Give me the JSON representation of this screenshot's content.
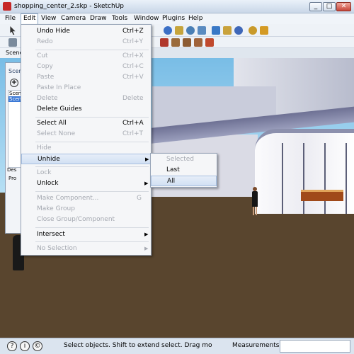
{
  "window": {
    "title": "shopping_center_2.skp - SketchUp",
    "min": "_",
    "max": "□",
    "close": "✕"
  },
  "menubar": [
    "File",
    "Edit",
    "View",
    "Camera",
    "Draw",
    "Tools",
    "Window",
    "Plugins",
    "Help"
  ],
  "scenes_tab": "Scene",
  "scenes_panel": {
    "title": "Scen",
    "list_header": "Scen",
    "selected_item": "Scen",
    "desc_label": "Des",
    "props_label": "Pro"
  },
  "edit_menu": [
    {
      "label": "Undo Hide",
      "shortcut": "Ctrl+Z",
      "enabled": true
    },
    {
      "label": "Redo",
      "shortcut": "Ctrl+Y",
      "enabled": false
    },
    {
      "label": "Cut",
      "shortcut": "Ctrl+X",
      "enabled": false
    },
    {
      "label": "Copy",
      "shortcut": "Ctrl+C",
      "enabled": false
    },
    {
      "label": "Paste",
      "shortcut": "Ctrl+V",
      "enabled": false
    },
    {
      "label": "Paste In Place",
      "shortcut": "",
      "enabled": false
    },
    {
      "label": "Delete",
      "shortcut": "Delete",
      "enabled": false
    },
    {
      "label": "Delete Guides",
      "shortcut": "",
      "enabled": true
    },
    {
      "label": "Select All",
      "shortcut": "Ctrl+A",
      "enabled": true
    },
    {
      "label": "Select None",
      "shortcut": "Ctrl+T",
      "enabled": false
    },
    {
      "label": "Hide",
      "shortcut": "",
      "enabled": false
    },
    {
      "label": "Unhide",
      "shortcut": "",
      "enabled": true,
      "submenu": true
    },
    {
      "label": "Lock",
      "shortcut": "",
      "enabled": false
    },
    {
      "label": "Unlock",
      "shortcut": "",
      "enabled": true,
      "submenu": true
    },
    {
      "label": "Make Component...",
      "shortcut": "G",
      "enabled": false
    },
    {
      "label": "Make Group",
      "shortcut": "",
      "enabled": false
    },
    {
      "label": "Close Group/Component",
      "shortcut": "",
      "enabled": false
    },
    {
      "label": "Intersect",
      "shortcut": "",
      "enabled": true,
      "submenu": true
    },
    {
      "label": "No Selection",
      "shortcut": "",
      "enabled": false,
      "submenu": true
    }
  ],
  "unhide_submenu": [
    {
      "label": "Selected",
      "enabled": false
    },
    {
      "label": "Last",
      "enabled": true
    },
    {
      "label": "All",
      "enabled": true
    }
  ],
  "statusbar": {
    "hint": "Select objects. Shift to extend select. Drag mo",
    "measurements_label": "Measurements",
    "measurements_value": "",
    "icon1": "?",
    "icon2": "i",
    "icon3": "©"
  },
  "submenu_arrow": "▶"
}
